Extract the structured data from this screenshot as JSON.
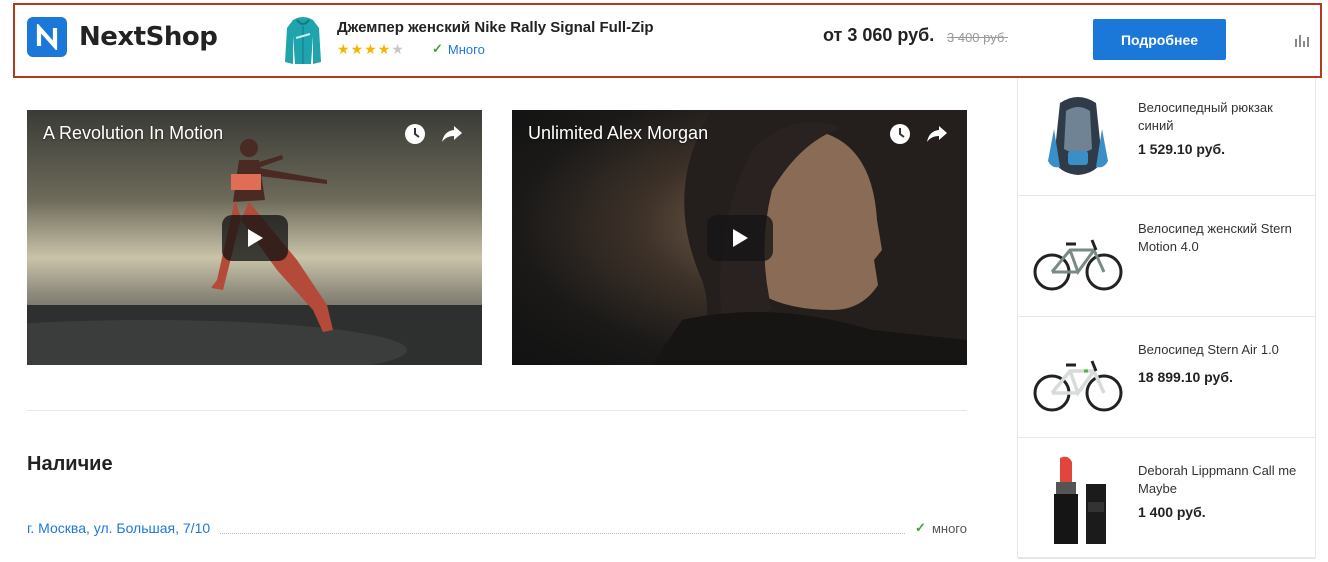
{
  "header": {
    "logo_text": "NextShop",
    "product_title": "Джемпер женский Nike Rally Signal Full-Zip",
    "rating": 4,
    "rating_max": 5,
    "stock_label": "Много",
    "price": "от 3 060 руб.",
    "old_price": "3 400 руб.",
    "button_label": "Подробнее",
    "colors": {
      "accent": "#1c78d8",
      "border": "#b33a22",
      "star": "#f5b400",
      "check": "#3ca635"
    }
  },
  "videos": [
    {
      "title": "A Revolution In Motion",
      "icons": [
        "clock-icon",
        "share-icon",
        "play-icon"
      ]
    },
    {
      "title": "Unlimited Alex Morgan",
      "icons": [
        "clock-icon",
        "share-icon",
        "play-icon"
      ]
    }
  ],
  "availability": {
    "title": "Наличие",
    "stores": [
      {
        "address": "г. Москва, ул. Большая, 7/10",
        "stock": "много"
      }
    ]
  },
  "sidebar": {
    "items": [
      {
        "name": "Велосипедный рюкзак синий",
        "price": "1 529.10 руб."
      },
      {
        "name": "Велосипед женский Stern Motion 4.0",
        "price": ""
      },
      {
        "name": "Велосипед Stern Air 1.0",
        "price": "18 899.10 руб."
      },
      {
        "name": "Deborah Lippmann Call me Maybe",
        "price": "1 400 руб."
      }
    ]
  }
}
